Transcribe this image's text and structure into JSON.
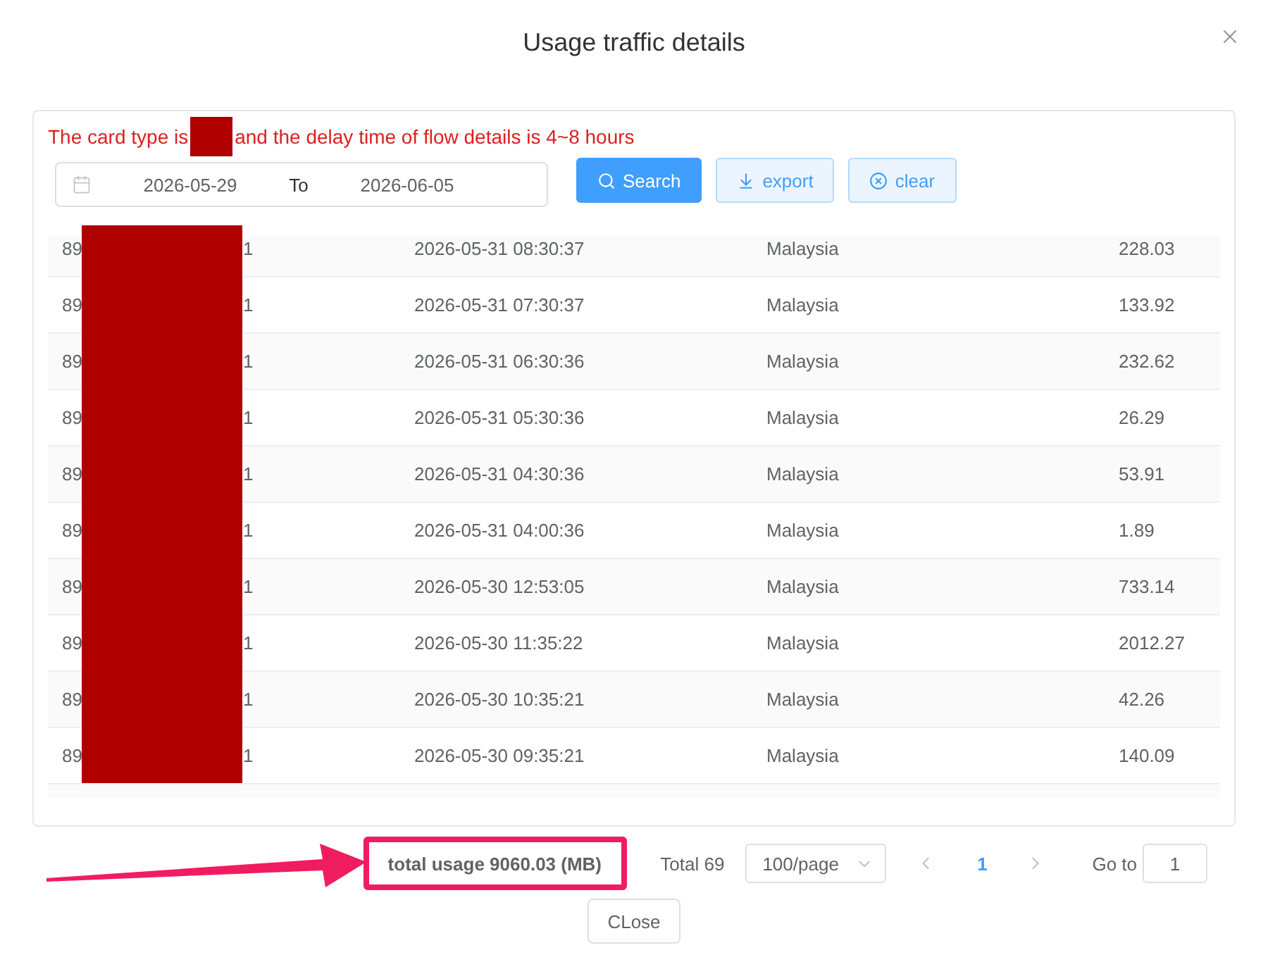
{
  "dialog": {
    "title": "Usage traffic details"
  },
  "notice": {
    "before": "The card type is",
    "redacted": true,
    "after": "and the delay time of flow details is 4~8 hours"
  },
  "filters": {
    "start_date": "2026-05-29",
    "separator": "To",
    "end_date": "2026-06-05"
  },
  "buttons": [
    {
      "kind": "search",
      "label": "Search"
    },
    {
      "kind": "export",
      "label": "export"
    },
    {
      "kind": "clear",
      "label": "clear"
    }
  ],
  "table": {
    "redacted": true,
    "rows": [
      {
        "column_1": {
          "start": "89",
          "end": "1"
        },
        "column_2": "2026-05-31 08:30:37",
        "column_3": "Malaysia",
        "column_4": "228.03"
      },
      {
        "column_1": {
          "start": "89",
          "end": "1"
        },
        "column_2": "2026-05-31 07:30:37",
        "column_3": "Malaysia",
        "column_4": "133.92"
      },
      {
        "column_1": {
          "start": "89",
          "end": "1"
        },
        "column_2": "2026-05-31 06:30:36",
        "column_3": "Malaysia",
        "column_4": "232.62"
      },
      {
        "column_1": {
          "start": "89",
          "end": "1"
        },
        "column_2": "2026-05-31 05:30:36",
        "column_3": "Malaysia",
        "column_4": "26.29"
      },
      {
        "column_1": {
          "start": "89",
          "end": "1"
        },
        "column_2": "2026-05-31 04:30:36",
        "column_3": "Malaysia",
        "column_4": "53.91"
      },
      {
        "column_1": {
          "start": "89",
          "end": "1"
        },
        "column_2": "2026-05-31 04:00:36",
        "column_3": "Malaysia",
        "column_4": "1.89"
      },
      {
        "column_1": {
          "start": "89",
          "end": "1"
        },
        "column_2": "2026-05-30 12:53:05",
        "column_3": "Malaysia",
        "column_4": "733.14"
      },
      {
        "column_1": {
          "start": "89",
          "end": "1"
        },
        "column_2": "2026-05-30 11:35:22",
        "column_3": "Malaysia",
        "column_4": "2012.27"
      },
      {
        "column_1": {
          "start": "89",
          "end": "1"
        },
        "column_2": "2026-05-30 10:35:21",
        "column_3": "Malaysia",
        "column_4": "42.26"
      },
      {
        "column_1": {
          "start": "89",
          "end": "1"
        },
        "column_2": "2026-05-30 09:35:21",
        "column_3": "Malaysia",
        "column_4": "140.09"
      }
    ]
  },
  "footer": {
    "total_usage": {
      "text": "total usage 9060.03 (MB)",
      "highlighted": true,
      "arrow": true
    },
    "total": "Total 69",
    "page_size": "100/page",
    "prev_disabled": true,
    "pages": [
      {
        "label": "1",
        "selected": true
      }
    ],
    "next_disabled": true,
    "goto_label": "Go to",
    "goto_value": "1"
  },
  "close_button": "CLose"
}
